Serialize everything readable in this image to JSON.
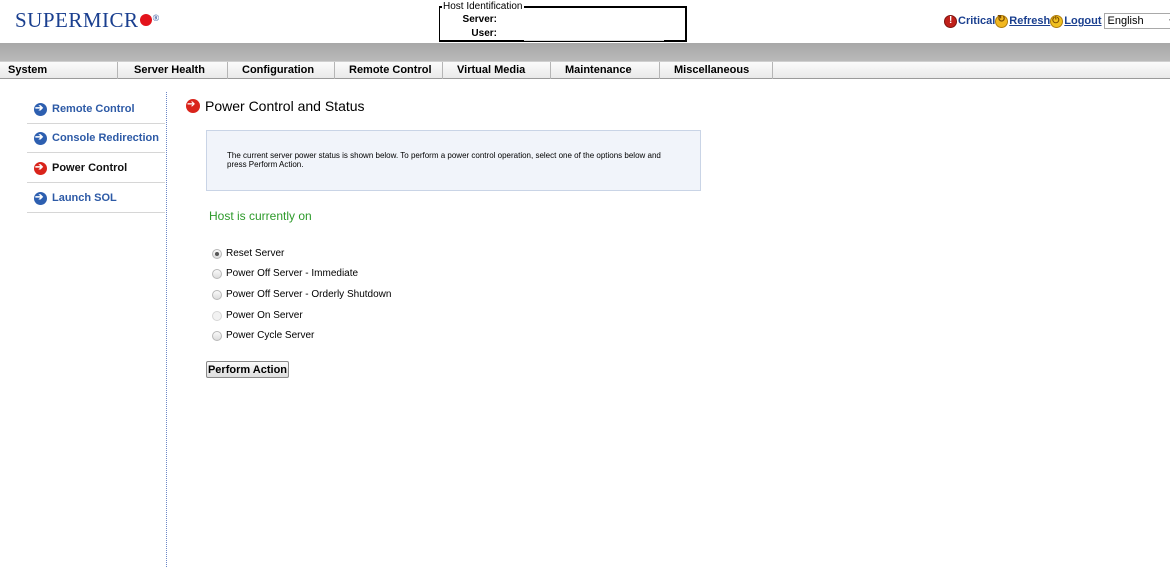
{
  "brand": {
    "logo_text": "SUPERMICR",
    "registered": "®",
    "brand_red": "#e3131b",
    "brand_blue": "#1a3f8f"
  },
  "host_identification": {
    "legend": "Host Identification",
    "server_label": "Server:",
    "server_value": "",
    "user_label": "User:",
    "user_value": ""
  },
  "top_links": {
    "critical": "Critical",
    "refresh": "Refresh",
    "logout": "Logout",
    "language": "English",
    "critical_icon": "critical-icon",
    "refresh_icon": "refresh-icon",
    "logout_icon": "logout-icon"
  },
  "nav": {
    "items": [
      "System",
      "Server Health",
      "Configuration",
      "Remote Control",
      "Virtual Media",
      "Maintenance",
      "Miscellaneous"
    ]
  },
  "sidebar": {
    "items": [
      {
        "label": "Remote Control",
        "icon": "arrow-right-icon"
      },
      {
        "label": "Console Redirection",
        "icon": "arrow-right-icon"
      },
      {
        "label": "Power Control",
        "icon": "arrow-right-icon",
        "active": true
      },
      {
        "label": "Launch SOL",
        "icon": "arrow-right-icon"
      }
    ]
  },
  "main": {
    "title": "Power Control and Status",
    "info_text": "The current server power status is shown below. To perform a power control operation, select one of the options below and press Perform Action.",
    "host_status": "Host is currently on",
    "status_color": "#2d9a2a",
    "options": [
      {
        "label": "Reset Server",
        "selected": true,
        "enabled": true
      },
      {
        "label": "Power Off Server - Immediate",
        "selected": false,
        "enabled": true
      },
      {
        "label": "Power Off Server - Orderly Shutdown",
        "selected": false,
        "enabled": true
      },
      {
        "label": "Power On Server",
        "selected": false,
        "enabled": false
      },
      {
        "label": "Power Cycle Server",
        "selected": false,
        "enabled": true
      }
    ],
    "perform_button": "Perform Action"
  }
}
